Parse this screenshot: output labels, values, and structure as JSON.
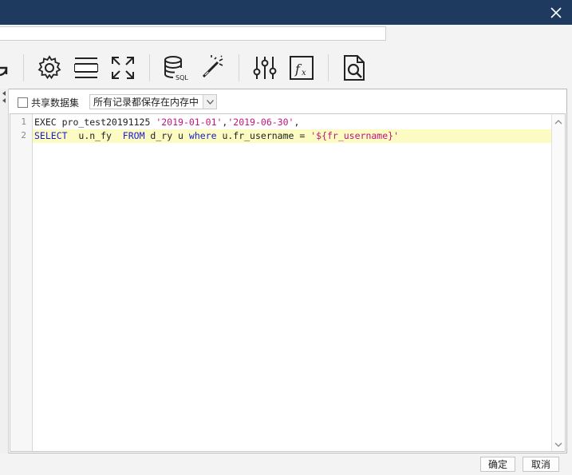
{
  "toolbar": {
    "icons": [
      "refresh-icon",
      "settings-gear-icon",
      "row-split-icon",
      "expand-icon",
      "database-sql-icon",
      "magic-wand-icon",
      "sliders-icon",
      "function-fx-icon",
      "document-preview-icon"
    ]
  },
  "dataset": {
    "shared_label": "共享数据集",
    "cache_select": "所有记录都保存在内存中"
  },
  "editor": {
    "line_numbers": [
      "1",
      "2"
    ],
    "line1": {
      "prefix": "EXEC pro_test20191125 ",
      "arg1": "'2019-01-01'",
      "comma1": ",",
      "arg2": "'2019-06-30'",
      "comma2": ","
    },
    "line2": {
      "kw_select": "SELECT",
      "cols": "  u.n_fy  ",
      "kw_from": "FROM",
      "table": " d_ry u ",
      "kw_where": "where",
      "cond": " u.fr_username = ",
      "param": "'${fr_username}'"
    }
  },
  "footer": {
    "ok": "确定",
    "cancel": "取消"
  },
  "colors": {
    "titlebar": "#1e3a5f",
    "keyword": "#1a1ad6",
    "string": "#c0157f",
    "highlight_line": "#fbfbc2"
  }
}
